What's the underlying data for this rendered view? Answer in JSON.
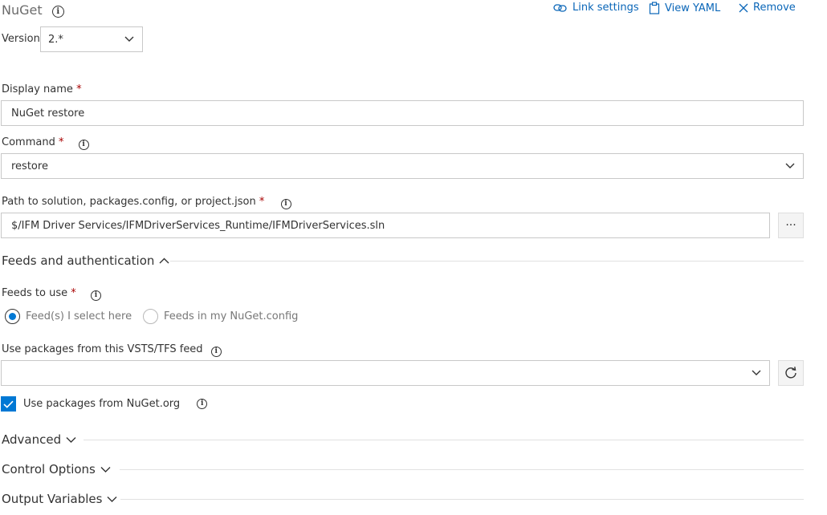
{
  "header": {
    "title": "NuGet",
    "actions": {
      "link_settings": "Link settings",
      "view_yaml": "View YAML",
      "remove": "Remove"
    }
  },
  "version": {
    "label": "Version",
    "value": "2.*"
  },
  "display_name": {
    "label": "Display name",
    "required_mark": "*",
    "value": "NuGet restore"
  },
  "command": {
    "label": "Command",
    "required_mark": "*",
    "value": "restore"
  },
  "path": {
    "label": "Path to solution, packages.config, or project.json",
    "required_mark": "*",
    "value": "$/IFM Driver Services/IFMDriverServices_Runtime/IFMDriverServices.sln",
    "browse_label": "···"
  },
  "feeds_section": {
    "title": "Feeds and authentication",
    "expanded": true
  },
  "feeds_to_use": {
    "label": "Feeds to use",
    "required_mark": "*",
    "options": [
      {
        "label": "Feed(s) I select here",
        "selected": true
      },
      {
        "label": "Feeds in my NuGet.config",
        "selected": false
      }
    ]
  },
  "vsts_feed": {
    "label": "Use packages from this VSTS/TFS feed",
    "value": ""
  },
  "nuget_org": {
    "label": "Use packages from NuGet.org",
    "checked": true
  },
  "sections": {
    "advanced": "Advanced",
    "control_options": "Control Options",
    "output_variables": "Output Variables"
  },
  "colors": {
    "accent": "#0078d4",
    "link": "#0a66b8",
    "required": "#a80000"
  },
  "icons": {
    "info": "info-icon",
    "link": "link-icon",
    "yaml": "clipboard-icon",
    "remove": "close-icon",
    "chevron": "chevron-down-icon",
    "refresh": "refresh-icon",
    "check": "checkmark-icon"
  }
}
